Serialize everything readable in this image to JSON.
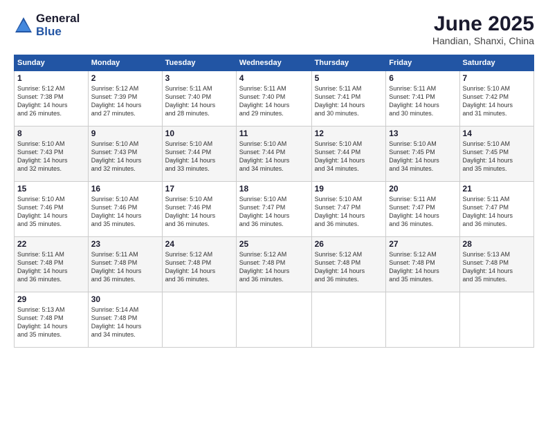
{
  "logo": {
    "general": "General",
    "blue": "Blue"
  },
  "title": "June 2025",
  "location": "Handian, Shanxi, China",
  "weekdays": [
    "Sunday",
    "Monday",
    "Tuesday",
    "Wednesday",
    "Thursday",
    "Friday",
    "Saturday"
  ],
  "weeks": [
    [
      {
        "day": "1",
        "info": "Sunrise: 5:12 AM\nSunset: 7:38 PM\nDaylight: 14 hours\nand 26 minutes."
      },
      {
        "day": "2",
        "info": "Sunrise: 5:12 AM\nSunset: 7:39 PM\nDaylight: 14 hours\nand 27 minutes."
      },
      {
        "day": "3",
        "info": "Sunrise: 5:11 AM\nSunset: 7:40 PM\nDaylight: 14 hours\nand 28 minutes."
      },
      {
        "day": "4",
        "info": "Sunrise: 5:11 AM\nSunset: 7:40 PM\nDaylight: 14 hours\nand 29 minutes."
      },
      {
        "day": "5",
        "info": "Sunrise: 5:11 AM\nSunset: 7:41 PM\nDaylight: 14 hours\nand 30 minutes."
      },
      {
        "day": "6",
        "info": "Sunrise: 5:11 AM\nSunset: 7:41 PM\nDaylight: 14 hours\nand 30 minutes."
      },
      {
        "day": "7",
        "info": "Sunrise: 5:10 AM\nSunset: 7:42 PM\nDaylight: 14 hours\nand 31 minutes."
      }
    ],
    [
      {
        "day": "8",
        "info": "Sunrise: 5:10 AM\nSunset: 7:43 PM\nDaylight: 14 hours\nand 32 minutes."
      },
      {
        "day": "9",
        "info": "Sunrise: 5:10 AM\nSunset: 7:43 PM\nDaylight: 14 hours\nand 32 minutes."
      },
      {
        "day": "10",
        "info": "Sunrise: 5:10 AM\nSunset: 7:44 PM\nDaylight: 14 hours\nand 33 minutes."
      },
      {
        "day": "11",
        "info": "Sunrise: 5:10 AM\nSunset: 7:44 PM\nDaylight: 14 hours\nand 34 minutes."
      },
      {
        "day": "12",
        "info": "Sunrise: 5:10 AM\nSunset: 7:44 PM\nDaylight: 14 hours\nand 34 minutes."
      },
      {
        "day": "13",
        "info": "Sunrise: 5:10 AM\nSunset: 7:45 PM\nDaylight: 14 hours\nand 34 minutes."
      },
      {
        "day": "14",
        "info": "Sunrise: 5:10 AM\nSunset: 7:45 PM\nDaylight: 14 hours\nand 35 minutes."
      }
    ],
    [
      {
        "day": "15",
        "info": "Sunrise: 5:10 AM\nSunset: 7:46 PM\nDaylight: 14 hours\nand 35 minutes."
      },
      {
        "day": "16",
        "info": "Sunrise: 5:10 AM\nSunset: 7:46 PM\nDaylight: 14 hours\nand 35 minutes."
      },
      {
        "day": "17",
        "info": "Sunrise: 5:10 AM\nSunset: 7:46 PM\nDaylight: 14 hours\nand 36 minutes."
      },
      {
        "day": "18",
        "info": "Sunrise: 5:10 AM\nSunset: 7:47 PM\nDaylight: 14 hours\nand 36 minutes."
      },
      {
        "day": "19",
        "info": "Sunrise: 5:10 AM\nSunset: 7:47 PM\nDaylight: 14 hours\nand 36 minutes."
      },
      {
        "day": "20",
        "info": "Sunrise: 5:11 AM\nSunset: 7:47 PM\nDaylight: 14 hours\nand 36 minutes."
      },
      {
        "day": "21",
        "info": "Sunrise: 5:11 AM\nSunset: 7:47 PM\nDaylight: 14 hours\nand 36 minutes."
      }
    ],
    [
      {
        "day": "22",
        "info": "Sunrise: 5:11 AM\nSunset: 7:48 PM\nDaylight: 14 hours\nand 36 minutes."
      },
      {
        "day": "23",
        "info": "Sunrise: 5:11 AM\nSunset: 7:48 PM\nDaylight: 14 hours\nand 36 minutes."
      },
      {
        "day": "24",
        "info": "Sunrise: 5:12 AM\nSunset: 7:48 PM\nDaylight: 14 hours\nand 36 minutes."
      },
      {
        "day": "25",
        "info": "Sunrise: 5:12 AM\nSunset: 7:48 PM\nDaylight: 14 hours\nand 36 minutes."
      },
      {
        "day": "26",
        "info": "Sunrise: 5:12 AM\nSunset: 7:48 PM\nDaylight: 14 hours\nand 36 minutes."
      },
      {
        "day": "27",
        "info": "Sunrise: 5:12 AM\nSunset: 7:48 PM\nDaylight: 14 hours\nand 35 minutes."
      },
      {
        "day": "28",
        "info": "Sunrise: 5:13 AM\nSunset: 7:48 PM\nDaylight: 14 hours\nand 35 minutes."
      }
    ],
    [
      {
        "day": "29",
        "info": "Sunrise: 5:13 AM\nSunset: 7:48 PM\nDaylight: 14 hours\nand 35 minutes."
      },
      {
        "day": "30",
        "info": "Sunrise: 5:14 AM\nSunset: 7:48 PM\nDaylight: 14 hours\nand 34 minutes."
      },
      {
        "day": "",
        "info": ""
      },
      {
        "day": "",
        "info": ""
      },
      {
        "day": "",
        "info": ""
      },
      {
        "day": "",
        "info": ""
      },
      {
        "day": "",
        "info": ""
      }
    ]
  ]
}
